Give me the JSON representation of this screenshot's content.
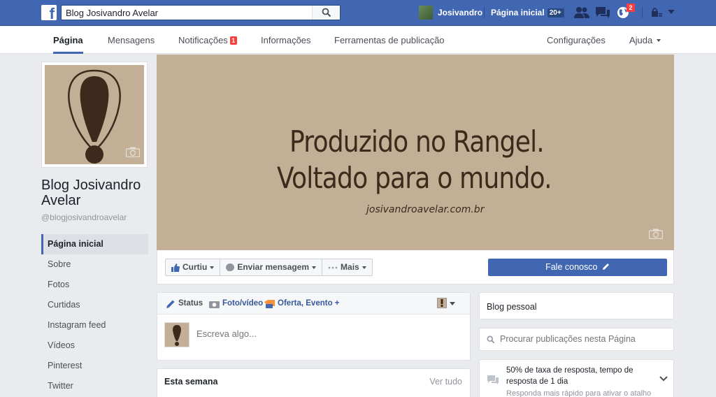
{
  "topbar": {
    "logo": "f",
    "search_value": "Blog Josivandro Avelar",
    "user_name": "Josivandro",
    "home_label": "Página inicial",
    "home_count": "20+",
    "notifications_count": "2"
  },
  "pagenav": {
    "items": [
      "Página",
      "Mensagens",
      "Notificações",
      "Informações",
      "Ferramentas de publicação"
    ],
    "notif_badge": "1",
    "settings": "Configurações",
    "help": "Ajuda"
  },
  "profile": {
    "name": "Blog Josivandro Avelar",
    "handle": "@blogjosivandroavelar"
  },
  "leftnav": {
    "items": [
      "Página inicial",
      "Sobre",
      "Fotos",
      "Curtidas",
      "Instagram feed",
      "Vídeos",
      "Pinterest",
      "Twitter"
    ]
  },
  "cover": {
    "line1": "Produzido no Rangel.",
    "line2": "Voltado para o mundo.",
    "url": "josivandroavelar.com.br"
  },
  "actions": {
    "like": "Curtiu",
    "message": "Enviar mensagem",
    "more": "Mais",
    "cta": "Fale conosco"
  },
  "composer": {
    "tabs": [
      "Status",
      "Foto/vídeo",
      "Oferta, Evento +"
    ],
    "placeholder": "Escreva algo..."
  },
  "thisweek": {
    "title": "Esta semana",
    "link": "Ver tudo"
  },
  "sidebar": {
    "category": "Blog pessoal",
    "search_placeholder": "Procurar publicações nesta Página",
    "response_text": "50% de taxa de resposta, tempo de resposta de 1 dia",
    "response_sub": "Responda mais rápido para ativar o atalho"
  },
  "colors": {
    "brand_blue": "#4267b2",
    "cover_bg": "#c2af96",
    "cover_text": "#3d2a1c",
    "badge_red": "#fa3e3e"
  }
}
